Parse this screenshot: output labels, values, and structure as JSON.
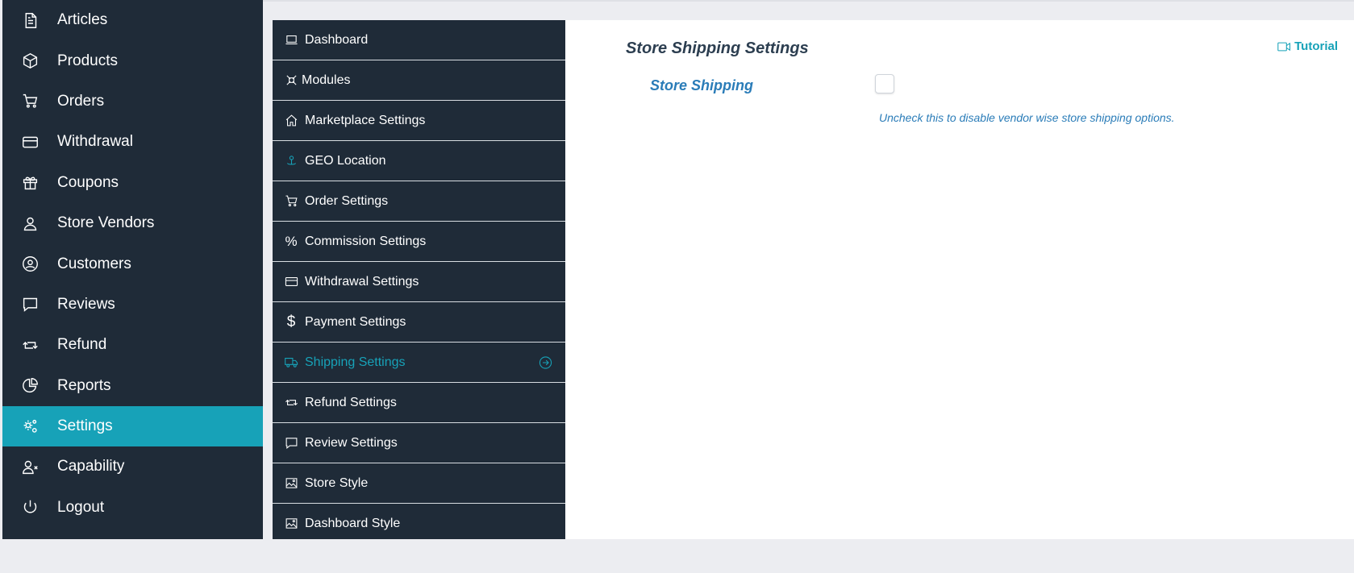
{
  "main_sidebar": {
    "items": [
      {
        "label": "Articles",
        "icon": "document-icon"
      },
      {
        "label": "Products",
        "icon": "cube-icon"
      },
      {
        "label": "Orders",
        "icon": "cart-icon"
      },
      {
        "label": "Withdrawal",
        "icon": "credit-card-icon"
      },
      {
        "label": "Coupons",
        "icon": "gift-icon"
      },
      {
        "label": "Store Vendors",
        "icon": "user-icon"
      },
      {
        "label": "Customers",
        "icon": "user-circle-icon"
      },
      {
        "label": "Reviews",
        "icon": "comment-icon"
      },
      {
        "label": "Refund",
        "icon": "retweet-icon"
      },
      {
        "label": "Reports",
        "icon": "pie-chart-icon"
      },
      {
        "label": "Settings",
        "icon": "cogs-icon",
        "active": true
      },
      {
        "label": "Capability",
        "icon": "user-times-icon"
      },
      {
        "label": "Logout",
        "icon": "power-icon"
      }
    ]
  },
  "settings_menu": {
    "items": [
      {
        "label": "Dashboard",
        "icon": "laptop-icon"
      },
      {
        "label": "Modules",
        "icon": "modules-icon"
      },
      {
        "label": "Marketplace Settings",
        "icon": "home-icon"
      },
      {
        "label": "GEO Location",
        "icon": "map-marker-icon"
      },
      {
        "label": "Order Settings",
        "icon": "cart-icon"
      },
      {
        "label": "Commission Settings",
        "icon": "percent-icon"
      },
      {
        "label": "Withdrawal Settings",
        "icon": "credit-card-icon"
      },
      {
        "label": "Payment Settings",
        "icon": "dollar-icon"
      },
      {
        "label": "Shipping Settings",
        "icon": "truck-icon",
        "active": true
      },
      {
        "label": "Refund Settings",
        "icon": "retweet-icon"
      },
      {
        "label": "Review Settings",
        "icon": "comment-icon"
      },
      {
        "label": "Store Style",
        "icon": "image-icon"
      },
      {
        "label": "Dashboard Style",
        "icon": "image-icon"
      }
    ]
  },
  "content": {
    "title": "Store Shipping Settings",
    "tutorial_label": "Tutorial",
    "field_label": "Store Shipping",
    "field_checked": false,
    "hint": "Uncheck this to disable vendor wise store shipping options."
  },
  "colors": {
    "sidebar_bg": "#1f2b38",
    "accent": "#17a2b8",
    "label_blue": "#2a7cb8",
    "page_bg": "#ecedf1"
  }
}
